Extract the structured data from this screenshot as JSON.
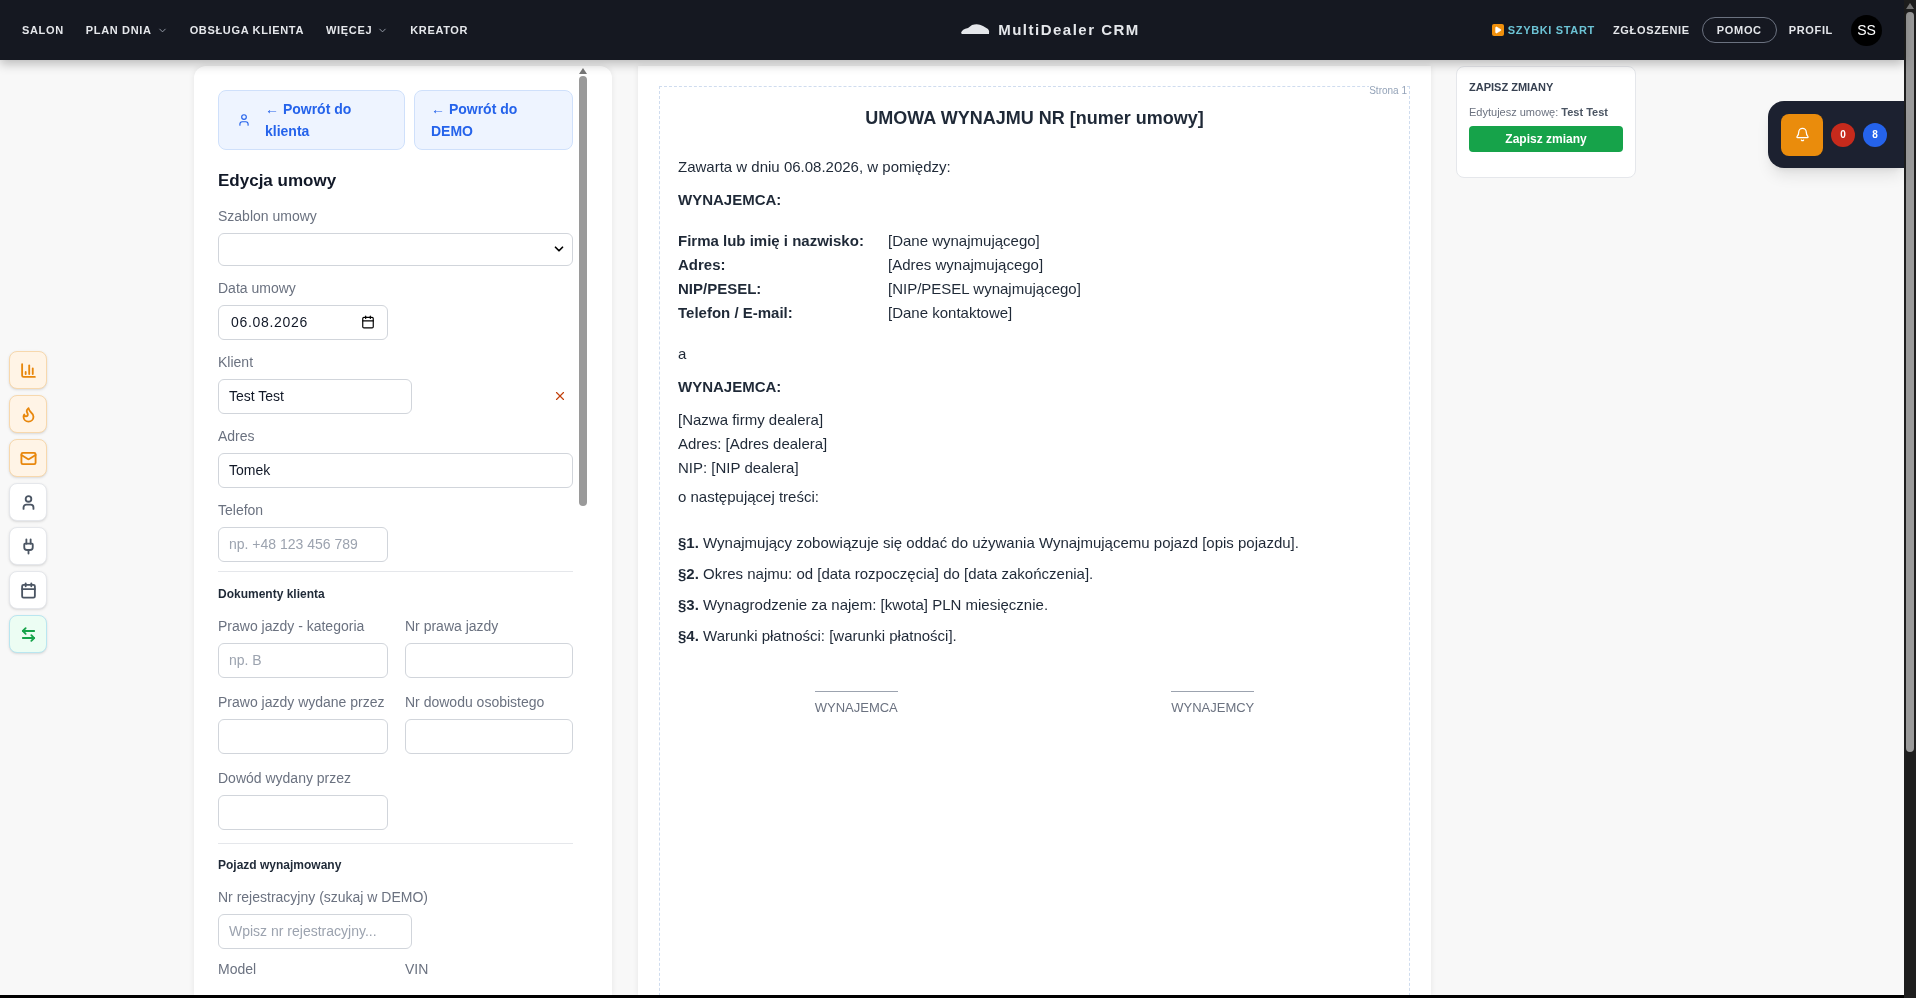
{
  "nav": {
    "items": [
      {
        "label": "SALON",
        "dropdown": false
      },
      {
        "label": "PLAN DNIA",
        "dropdown": true
      },
      {
        "label": "OBSŁUGA KLIENTA",
        "dropdown": false
      },
      {
        "label": "WIĘCEJ",
        "dropdown": true
      },
      {
        "label": "KREATOR",
        "dropdown": false
      }
    ],
    "brand": "MultiDealer CRM",
    "quick_start": "SZYBKI START",
    "report": "ZGŁOSZENIE",
    "help": "POMOC",
    "profile": "PROFIL",
    "avatar": "SS"
  },
  "side_buttons": [
    {
      "color": "#e8870c"
    },
    {
      "color": "#e8870c"
    },
    {
      "color": "#e8870c"
    },
    {
      "color": "#4b5563"
    },
    {
      "color": "#4b5563"
    },
    {
      "color": "#4b5563"
    },
    {
      "color": "#16a34a"
    }
  ],
  "editor": {
    "back_buttons": [
      "← Powrót do klienta",
      "← Powrót do DEMO"
    ],
    "title": "Edycja umowy",
    "template": {
      "label": "Szablon umowy"
    },
    "date": {
      "label": "Data umowy",
      "value": "06.08.2026"
    },
    "client": {
      "label": "Klient",
      "value": "Test Test"
    },
    "address": {
      "label": "Adres",
      "value": "Tomek"
    },
    "phone": {
      "label": "Telefon",
      "placeholder": "np. +48 123 456 789"
    },
    "documents": {
      "title": "Dokumenty klienta",
      "fields": [
        {
          "label": "Prawo jazdy - kategoria",
          "placeholder": "np. B"
        },
        {
          "label": "Nr prawa jazdy"
        },
        {
          "label": "Prawo jazdy wydane przez"
        },
        {
          "label": "Nr dowodu osobistego"
        },
        {
          "label": "Dowód wydany przez"
        }
      ]
    },
    "vehicle": {
      "title": "Pojazd wynajmowany",
      "search": {
        "label": "Nr rejestracyjny (szukaj w DEMO)",
        "placeholder": "Wpisz nr rejestracyjny..."
      },
      "more_labels": [
        "Model",
        "VIN"
      ]
    }
  },
  "document": {
    "page_label": "Strona 1",
    "title": "UMOWA WYNAJMU NR [numer umowy]",
    "intro": "Zawarta w dniu 06.08.2026, w pomiędzy:",
    "party1_heading": "WYNAJEMCA:",
    "party1_rows": [
      {
        "label": "Firma lub imię i nazwisko:",
        "value": "[Dane wynajmującego]"
      },
      {
        "label": "Adres:",
        "value": "[Adres wynajmującego]"
      },
      {
        "label": "NIP/PESEL:",
        "value": "[NIP/PESEL wynajmującego]"
      },
      {
        "label": "Telefon / E-mail:",
        "value": "[Dane kontaktowe]"
      }
    ],
    "conjunction": "a",
    "party2_heading": "WYNAJEMCA:",
    "party2_lines": [
      "[Nazwa firmy dealera]",
      "Adres: [Adres dealera]",
      "NIP: [NIP dealera]"
    ],
    "lead": "o następującej treści:",
    "clauses": [
      "**§1.** Wynajmujący zobowiązuje się oddać do używania Wynajmującemu pojazd [opis pojazdu].",
      "**§2.** Okres najmu: od [data rozpoczęcia] do [data zakończenia].",
      "**§3.** Wynagrodzenie za najem: [kwota] PLN miesięcznie.",
      "**§4.** Warunki płatności: [warunki płatności]."
    ],
    "signatures": [
      "WYNAJEMCA",
      "WYNAJEMCY"
    ]
  },
  "save_card": {
    "title": "ZAPISZ ZMIANY",
    "note": "Edytujesz umowę: **Test Test**",
    "button": "Zapisz zmiany"
  },
  "notifications": {
    "badges": [
      {
        "count": "0",
        "color": "#c62a1c"
      },
      {
        "count": "8",
        "color": "#2563eb"
      }
    ]
  }
}
